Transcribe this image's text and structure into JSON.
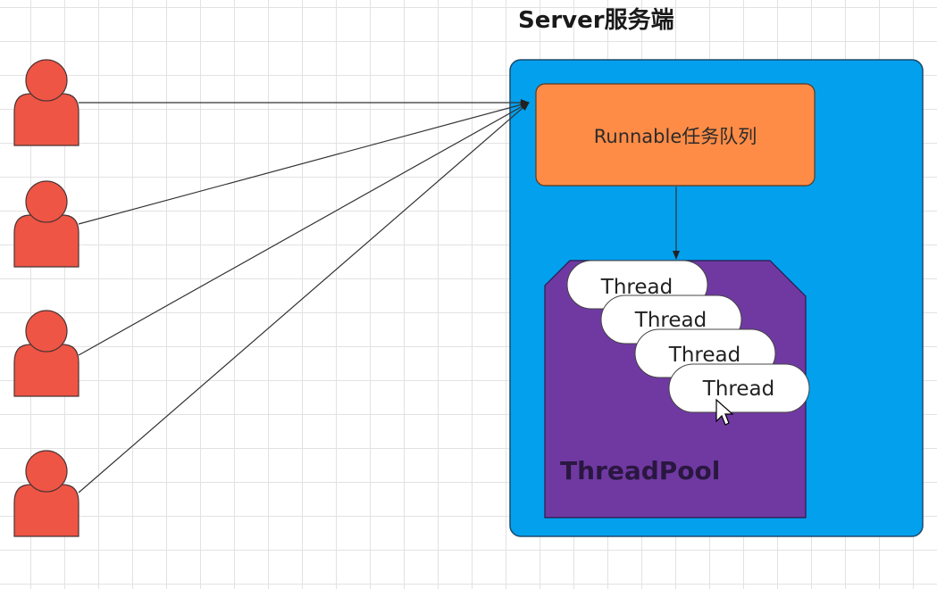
{
  "diagram": {
    "server_title": "Server服务端",
    "queue_label": "Runnable任务队列",
    "threads": [
      {
        "label": "Thread"
      },
      {
        "label": "Thread"
      },
      {
        "label": "Thread"
      },
      {
        "label": "Thread"
      }
    ],
    "pool_label": "ThreadPool",
    "clients": [
      {
        "icon": "user-icon"
      },
      {
        "icon": "user-icon"
      },
      {
        "icon": "user-icon"
      },
      {
        "icon": "user-icon"
      }
    ],
    "colors": {
      "client_fill": "#EE5545",
      "client_stroke": "#4a3333",
      "server_fill": "#03A0EE",
      "server_stroke": "#1b4a6b",
      "queue_fill": "#FF8C46",
      "queue_stroke": "#5a3a20",
      "pool_fill": "#7039A2",
      "pool_stroke": "#2a1a4a",
      "thread_fill": "#FFFFFF",
      "thread_stroke": "#444444",
      "grid_line": "#E2E2E2"
    }
  }
}
